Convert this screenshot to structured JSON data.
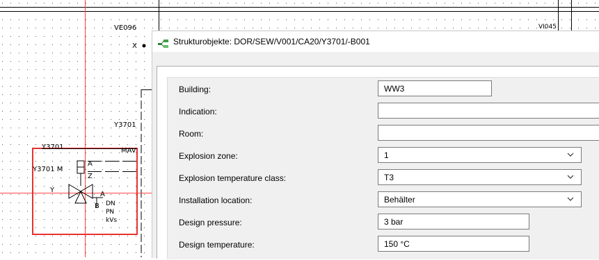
{
  "cad": {
    "labels": {
      "ve096": "VE096",
      "x_mark": "X",
      "vi045": "VI045",
      "y3701_mid": "Y3701",
      "y3701_tag": "Y3701",
      "mav": "MAV",
      "y3701_m": "Y3701",
      "m": "M",
      "a_top": "A",
      "z": "Z",
      "y": "Y",
      "a_valve": "A",
      "b": "B",
      "dn": "DN",
      "pn": "PN",
      "kvs": "kVs"
    },
    "colors": {
      "highlight": "#e8312f",
      "crosshair": "#ff4444",
      "lines": "#000000"
    }
  },
  "dialog": {
    "title": "Strukturobjekte: DOR/SEW/V001/CA20/Y3701/-B001",
    "icon": "tree-structure-icon",
    "fields": [
      {
        "label": "Building:",
        "value": "WW3",
        "type": "text"
      },
      {
        "label": "Indication:",
        "value": "",
        "type": "text"
      },
      {
        "label": "Room:",
        "value": "",
        "type": "text"
      },
      {
        "label": "Explosion zone:",
        "value": "1",
        "type": "select"
      },
      {
        "label": "Explosion temperature class:",
        "value": "T3",
        "type": "select"
      },
      {
        "label": "Installation location:",
        "value": "Behälter",
        "type": "select"
      },
      {
        "label": "Design pressure:",
        "value": "3 bar",
        "type": "text"
      },
      {
        "label": "Design temperature:",
        "value": "150 °C",
        "type": "text"
      }
    ]
  }
}
